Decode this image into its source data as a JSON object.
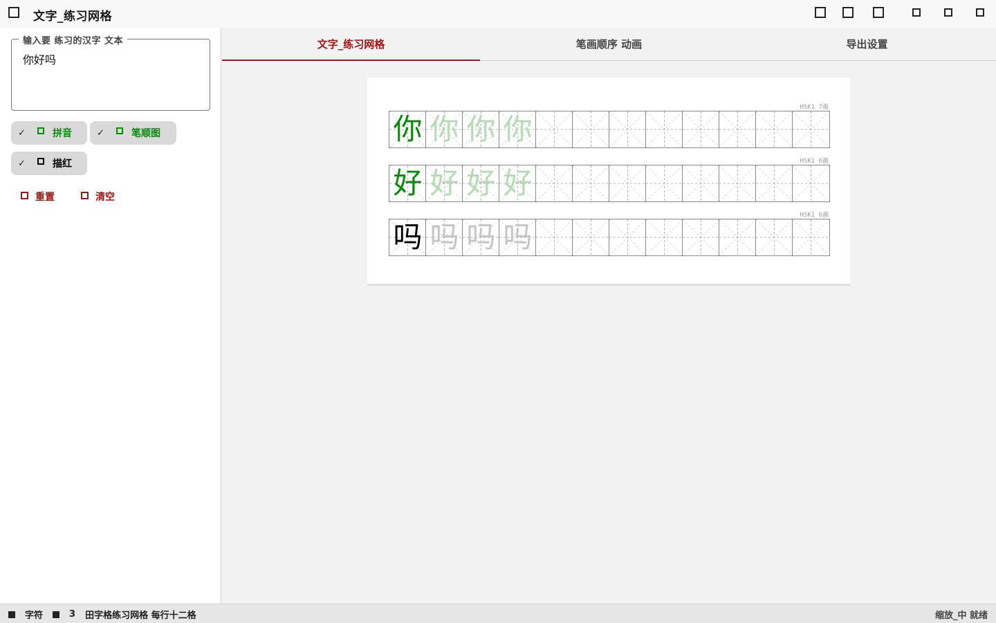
{
  "app": {
    "title": "文字_练习网格"
  },
  "titlebar_buttons": [
    {
      "icon": "open-icon"
    },
    {
      "icon": "save-icon"
    },
    {
      "icon": "print-icon"
    },
    {
      "icon": "minimize-icon"
    },
    {
      "icon": "maximize-icon"
    },
    {
      "icon": "close-icon"
    }
  ],
  "sidebar": {
    "input_legend": "输入要 练习的汉字 文本",
    "input_value": "你好吗",
    "chips": [
      {
        "label": "拼音",
        "icon": "pinyin-icon"
      },
      {
        "label": "笔顺图",
        "icon": "stroke-order-icon"
      },
      {
        "label": "描红",
        "icon": "trace-icon"
      }
    ],
    "actions": [
      {
        "label": "重置",
        "icon": "reset-icon"
      },
      {
        "label": "清空",
        "icon": "clear-icon"
      }
    ]
  },
  "tabs": [
    {
      "label": "文字_练习网格",
      "active": true
    },
    {
      "label": "笔画顺序 动画",
      "active": false
    },
    {
      "label": "导出设置",
      "active": false
    }
  ],
  "worksheet": {
    "rows": [
      {
        "char": "你",
        "meta": "HSK1 7画",
        "color": "#0a8a0a",
        "trace_color": "#b5dbb5",
        "cells": 12,
        "traces": 3
      },
      {
        "char": "好",
        "meta": "HSK1 6画",
        "color": "#0a8a0a",
        "trace_color": "#b5dbb5",
        "cells": 12,
        "traces": 3
      },
      {
        "char": "吗",
        "meta": "HSK1 6画",
        "color": "#000000",
        "trace_color": "#c4c4c4",
        "cells": 12,
        "traces": 3
      }
    ]
  },
  "statusbar": {
    "left_items": [
      "字符",
      "3",
      "田字格练习网格 每行十二格"
    ],
    "right": "缩放_中 就绪"
  },
  "colors": {
    "accent": "#a31515",
    "green": "#0a8a0a"
  }
}
